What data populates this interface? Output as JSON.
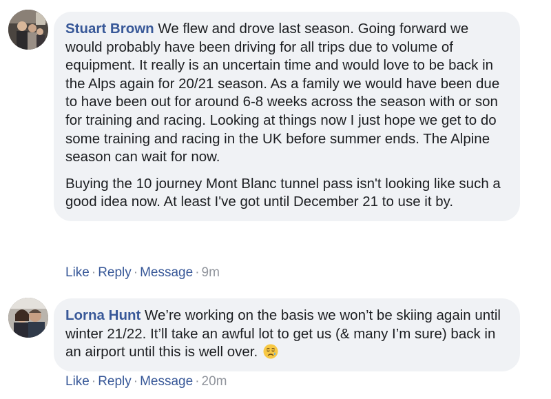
{
  "comments": [
    {
      "author": "Stuart Brown",
      "paragraphs": [
        "We flew and drove last season. Going forward we would probably have been driving for all trips due to volume of equipment. It really is an uncertain time and would love to be back in the Alps again for 20/21 season. As a family we would have been due to have been out for around 6-8 weeks across the season with or son for training and racing. Looking at things now I just hope we get to do some training and racing in the UK before summer ends. The Alpine season can wait for now.",
        "Buying the 10 journey Mont Blanc tunnel pass isn't looking like such a good idea now. At least I've got until December 21 to use it by."
      ],
      "actions": {
        "like": "Like",
        "reply": "Reply",
        "message": "Message",
        "separator": "·",
        "time": "9m"
      }
    },
    {
      "author": "Lorna Hunt",
      "text": "We’re working on the basis we won’t be skiing again until winter 21/22. It’ll take an awful lot to get us (& many I’m sure) back in an airport until this is well over.",
      "emoji": "sad-but-relieved-face-icon",
      "actions": {
        "like": "Like",
        "reply": "Reply",
        "message": "Message",
        "separator": "·",
        "time": "20m"
      }
    }
  ],
  "colors": {
    "author_link": "#385898",
    "bubble_background": "#f0f2f5",
    "meta_gray": "#90949c",
    "text": "#1c1e21"
  }
}
